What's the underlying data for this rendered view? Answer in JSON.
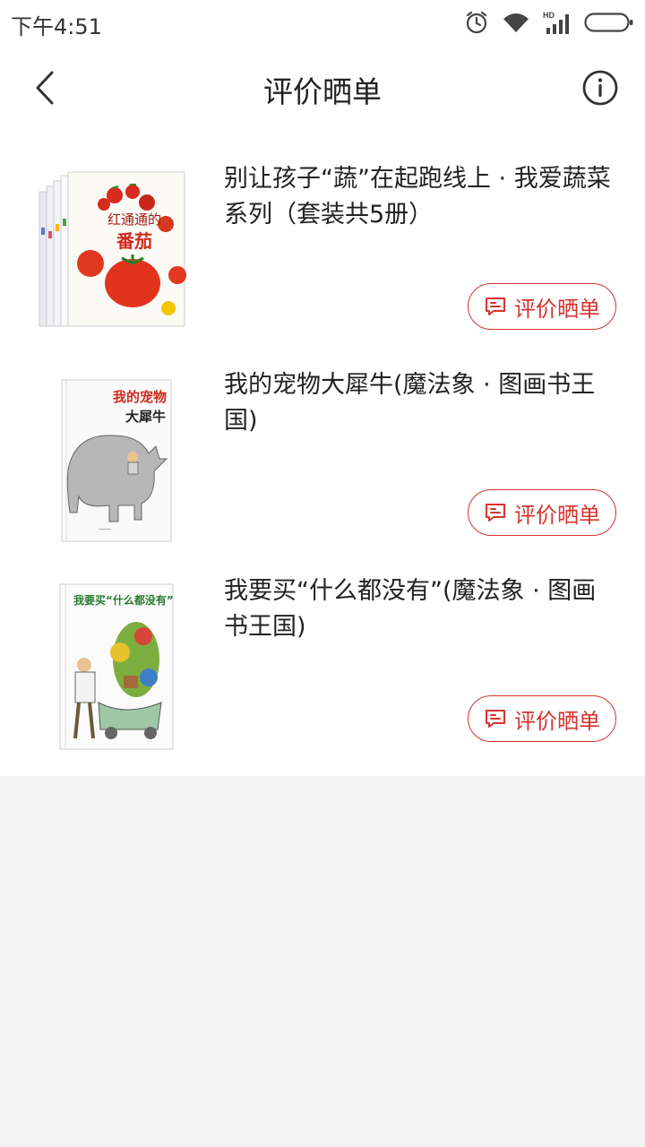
{
  "status_bar": {
    "time": "下午4:51",
    "icons": [
      "alarm-icon",
      "wifi-icon",
      "hd-signal-icon",
      "battery-icon"
    ],
    "hd_label": "HD"
  },
  "header": {
    "title": "评价晒单",
    "back_icon": "chevron-left-icon",
    "info_icon": "info-icon"
  },
  "products": [
    {
      "title": "别让孩子“蔬”在起跑线上 · 我爱蔬菜系列（套装共5册）",
      "cover_text": "红通通的",
      "cover_text_2": "番茄",
      "review_label": "评价晒单"
    },
    {
      "title": "我的宠物大犀牛(魔法象 · 图画书王国)",
      "cover_text": "我的宠物",
      "cover_text_2": "大犀牛",
      "review_label": "评价晒单"
    },
    {
      "title": "我要买“什么都没有”(魔法象 · 图画书王国)",
      "cover_text": "我要买“什么都没有”",
      "review_label": "评价晒单"
    }
  ],
  "colors": {
    "accent": "#d8322d",
    "background": "#f4f4f4",
    "surface": "#ffffff"
  }
}
